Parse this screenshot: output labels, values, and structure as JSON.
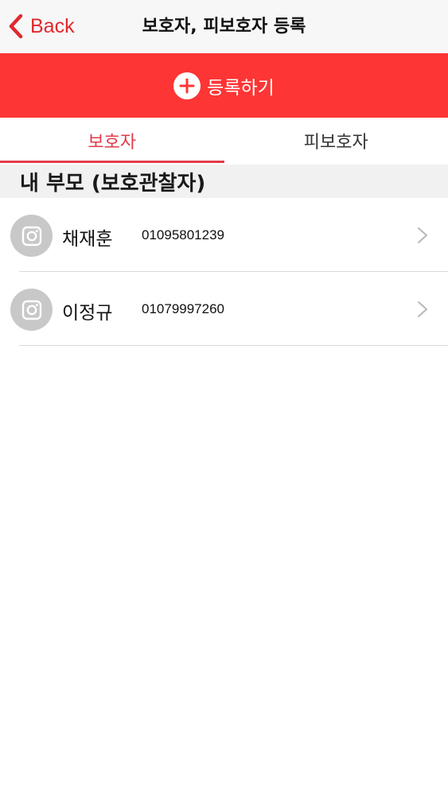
{
  "navbar": {
    "back_label": "Back",
    "title": "보호자, 피보호자 등록"
  },
  "register": {
    "label": "등록하기",
    "icon": "plus-circle-icon"
  },
  "tabs": [
    {
      "label": "보호자",
      "active": true
    },
    {
      "label": "피보호자",
      "active": false
    }
  ],
  "section": {
    "title": "내 부모 (보호관찰자)"
  },
  "contacts": [
    {
      "name": "채재훈",
      "phone": "01095801239",
      "avatar_icon": "camera-icon"
    },
    {
      "name": "이정규",
      "phone": "01079997260",
      "avatar_icon": "camera-icon"
    }
  ],
  "colors": {
    "accent": "#fd3535",
    "tab_active": "#e23c4a",
    "back": "#e0282e"
  }
}
